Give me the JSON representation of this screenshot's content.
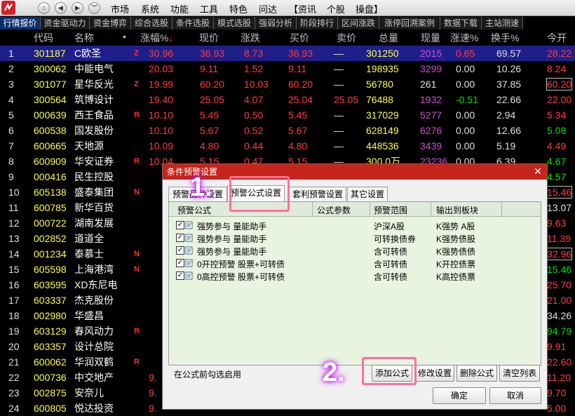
{
  "menubar": {
    "items": [
      "市场",
      "系统",
      "功能",
      "工具",
      "特色",
      "问达",
      "【资讯",
      "个股",
      "操盘】"
    ]
  },
  "tabs": [
    "行情报价",
    "资金驱动力",
    "资金博弈",
    "综合选股",
    "条件选股",
    "模式选股",
    "强弱分析",
    "阶段排行",
    "区间涨跌",
    "涨停回溯案例",
    "数据下载",
    "主站测速"
  ],
  "table": {
    "headers": [
      "代码",
      "名称",
      "•",
      "涨幅%",
      "现价",
      "涨跌",
      "买价",
      "卖价",
      "总量",
      "现量",
      "涨速%",
      "换手%",
      "今开"
    ],
    "rows": [
      {
        "idx": "1",
        "code": "301187",
        "name": "C欧圣",
        "flag": "Z",
        "pct": "30.96",
        "price": "36.93",
        "chg": "8.73",
        "bid": "36.93",
        "ask": "—",
        "vol": "301250",
        "cur": "2015",
        "spd": "0.65",
        "turn": "69.57",
        "open": "28.22"
      },
      {
        "idx": "2",
        "code": "300062",
        "name": "中能电气",
        "flag": "",
        "pct": "20.03",
        "price": "9.11",
        "chg": "1.52",
        "bid": "9.11",
        "ask": "—",
        "vol": "198935",
        "cur": "3299",
        "spd": "0.00",
        "turn": "10.26",
        "open": "8.24"
      },
      {
        "idx": "3",
        "code": "301077",
        "name": "星华反光",
        "flag": "Z",
        "pct": "19.99",
        "price": "60.20",
        "chg": "10.03",
        "bid": "60.20",
        "ask": "—",
        "vol": "56780",
        "cur": "261",
        "spd": "0.00",
        "turn": "37.85",
        "open": "60.20"
      },
      {
        "idx": "4",
        "code": "300564",
        "name": "筑博设计",
        "flag": "",
        "pct": "19.40",
        "price": "25.05",
        "chg": "4.07",
        "bid": "25.04",
        "ask": "25.05",
        "vol": "76488",
        "cur": "1932",
        "spd": "-0.51",
        "turn": "22.66",
        "open": "22.00"
      },
      {
        "idx": "5",
        "code": "000639",
        "name": "西王食品",
        "flag": "R",
        "pct": "10.10",
        "price": "5.45",
        "chg": "0.50",
        "bid": "5.45",
        "ask": "—",
        "vol": "317029",
        "cur": "5277",
        "spd": "0.00",
        "turn": "2.94",
        "open": "5.34"
      },
      {
        "idx": "6",
        "code": "600538",
        "name": "国发股份",
        "flag": "",
        "pct": "10.10",
        "price": "5.67",
        "chg": "0.52",
        "bid": "5.67",
        "ask": "—",
        "vol": "628149",
        "cur": "6276",
        "spd": "0.00",
        "turn": "12.66",
        "open": "5.08"
      },
      {
        "idx": "7",
        "code": "600665",
        "name": "天地源",
        "flag": "",
        "pct": "10.09",
        "price": "4.80",
        "chg": "0.44",
        "bid": "4.80",
        "ask": "—",
        "vol": "448536",
        "cur": "3439",
        "spd": "0.00",
        "turn": "5.19",
        "open": "4.49"
      },
      {
        "idx": "8",
        "code": "600909",
        "name": "华安证券",
        "flag": "R",
        "pct": "10.04",
        "price": "5.15",
        "chg": "0.47",
        "bid": "5.15",
        "ask": "—",
        "vol": "300.0万",
        "cur": "23236",
        "spd": "0.00",
        "turn": "6.39",
        "open": "4.67"
      },
      {
        "idx": "9",
        "code": "000416",
        "name": "民生控股",
        "flag": "",
        "pct": "",
        "price": "",
        "chg": "",
        "bid": "",
        "ask": "",
        "vol": "",
        "cur": "",
        "spd": "",
        "turn": "",
        "open": "4.57"
      },
      {
        "idx": "10",
        "code": "605138",
        "name": "盛泰集团",
        "flag": "N",
        "pct": "",
        "price": "",
        "chg": "",
        "bid": "",
        "ask": "",
        "vol": "",
        "cur": "",
        "spd": "",
        "turn": "",
        "open": "15.46"
      },
      {
        "idx": "11",
        "code": "600785",
        "name": "新华百货",
        "flag": "",
        "pct": "",
        "price": "",
        "chg": "",
        "bid": "",
        "ask": "",
        "vol": "",
        "cur": "",
        "spd": "",
        "turn": "",
        "open": "13.07"
      },
      {
        "idx": "12",
        "code": "000722",
        "name": "湖南发展",
        "flag": "",
        "pct": "",
        "price": "",
        "chg": "",
        "bid": "",
        "ask": "",
        "vol": "",
        "cur": "",
        "spd": "",
        "turn": "",
        "open": "9.63"
      },
      {
        "idx": "13",
        "code": "002852",
        "name": "道道全",
        "flag": "",
        "pct": "",
        "price": "",
        "chg": "",
        "bid": "",
        "ask": "",
        "vol": "",
        "cur": "",
        "spd": "",
        "turn": "",
        "open": "11.39"
      },
      {
        "idx": "14",
        "code": "001234",
        "name": "泰慕士",
        "flag": "N",
        "pct": "",
        "price": "",
        "chg": "",
        "bid": "",
        "ask": "",
        "vol": "",
        "cur": "",
        "spd": "",
        "turn": "",
        "open": "32.96"
      },
      {
        "idx": "15",
        "code": "605598",
        "name": "上海港湾",
        "flag": "N",
        "pct": "",
        "price": "",
        "chg": "",
        "bid": "",
        "ask": "",
        "vol": "",
        "cur": "",
        "spd": "",
        "turn": "",
        "open": "15.46"
      },
      {
        "idx": "16",
        "code": "603595",
        "name": "XD东尼电",
        "flag": "",
        "pct": "",
        "price": "",
        "chg": "",
        "bid": "",
        "ask": "",
        "vol": "",
        "cur": "",
        "spd": "",
        "turn": "",
        "open": "25.70"
      },
      {
        "idx": "17",
        "code": "603337",
        "name": "杰克股份",
        "flag": "",
        "pct": "",
        "price": "",
        "chg": "",
        "bid": "",
        "ask": "",
        "vol": "",
        "cur": "",
        "spd": "",
        "turn": "",
        "open": "21.00"
      },
      {
        "idx": "18",
        "code": "002980",
        "name": "华盛昌",
        "flag": "",
        "pct": "",
        "price": "",
        "chg": "",
        "bid": "",
        "ask": "",
        "vol": "",
        "cur": "",
        "spd": "",
        "turn": "",
        "open": "34.26"
      },
      {
        "idx": "19",
        "code": "603129",
        "name": "春风动力",
        "flag": "R",
        "pct": "",
        "price": "",
        "chg": "",
        "bid": "",
        "ask": "",
        "vol": "",
        "cur": "",
        "spd": "",
        "turn": "",
        "open": "94.79"
      },
      {
        "idx": "20",
        "code": "603357",
        "name": "设计总院",
        "flag": "",
        "pct": "",
        "price": "",
        "chg": "",
        "bid": "",
        "ask": "",
        "vol": "",
        "cur": "",
        "spd": "",
        "turn": "",
        "open": "9.91"
      },
      {
        "idx": "21",
        "code": "600062",
        "name": "华润双鹤",
        "flag": "R",
        "pct": "",
        "price": "",
        "chg": "",
        "bid": "",
        "ask": "",
        "vol": "",
        "cur": "",
        "spd": "",
        "turn": "",
        "open": "22.60"
      },
      {
        "idx": "22",
        "code": "000736",
        "name": "中交地产",
        "flag": "",
        "pct": "9.",
        "price": "",
        "chg": "",
        "bid": "",
        "ask": "",
        "vol": "",
        "cur": "",
        "spd": "",
        "turn": "",
        "open": "11.20"
      },
      {
        "idx": "23",
        "code": "002875",
        "name": "安奈儿",
        "flag": "",
        "pct": "9.",
        "price": "",
        "chg": "",
        "bid": "",
        "ask": "",
        "vol": "",
        "cur": "",
        "spd": "",
        "turn": "",
        "open": "9.70"
      },
      {
        "idx": "24",
        "code": "600805",
        "name": "悦达投资",
        "flag": "",
        "pct": "9.",
        "price": "",
        "chg": "",
        "bid": "",
        "ask": "",
        "vol": "",
        "cur": "",
        "spd": "",
        "turn": "",
        "open": "5.00"
      }
    ]
  },
  "dialog": {
    "title": "条件预警设置",
    "close": "✕",
    "tabs": [
      "预警品种设置",
      "预警公式设置",
      "套利预警设置",
      "其它设置"
    ],
    "list_headers": [
      "预警公式",
      "公式参数",
      "预警范围",
      "输出到板块"
    ],
    "items": [
      {
        "checked": "✓",
        "formula": "强势参与 量能助手",
        "param": "",
        "range": "沪深A股",
        "board": "K强势 A股"
      },
      {
        "checked": "✓",
        "formula": "强势参与 量能助手",
        "param": "",
        "range": "可转换债券",
        "board": "K强势债股"
      },
      {
        "checked": "✓",
        "formula": "强势参与 量能助手",
        "param": "",
        "range": "含可转债",
        "board": "K强势债债"
      },
      {
        "checked": "✓",
        "formula": "0开控预警 股票+可转债",
        "param": "",
        "range": "含可转债",
        "board": "K开控债票"
      },
      {
        "checked": "✓",
        "formula": "0高控预警 股票+可转债",
        "param": "",
        "range": "含可转债",
        "board": "K高控债票"
      }
    ],
    "hint": "在公式前勾选启用",
    "buttons": {
      "add": "添加公式",
      "edit": "修改设置",
      "delete": "删除公式",
      "clear": "清空列表",
      "ok": "确定",
      "cancel": "取消"
    }
  },
  "annotations": {
    "step1": "1.",
    "step2": "2."
  },
  "colors": {
    "up": "#ff3c3c",
    "down": "#00e000",
    "code": "#ffff40",
    "name": "#ffffff",
    "volume": "#ffff40",
    "current": "#d050d0",
    "neutral": "#e0e0e0",
    "dialog_title": "#c6251c",
    "highlight": "#ff6f9c"
  }
}
